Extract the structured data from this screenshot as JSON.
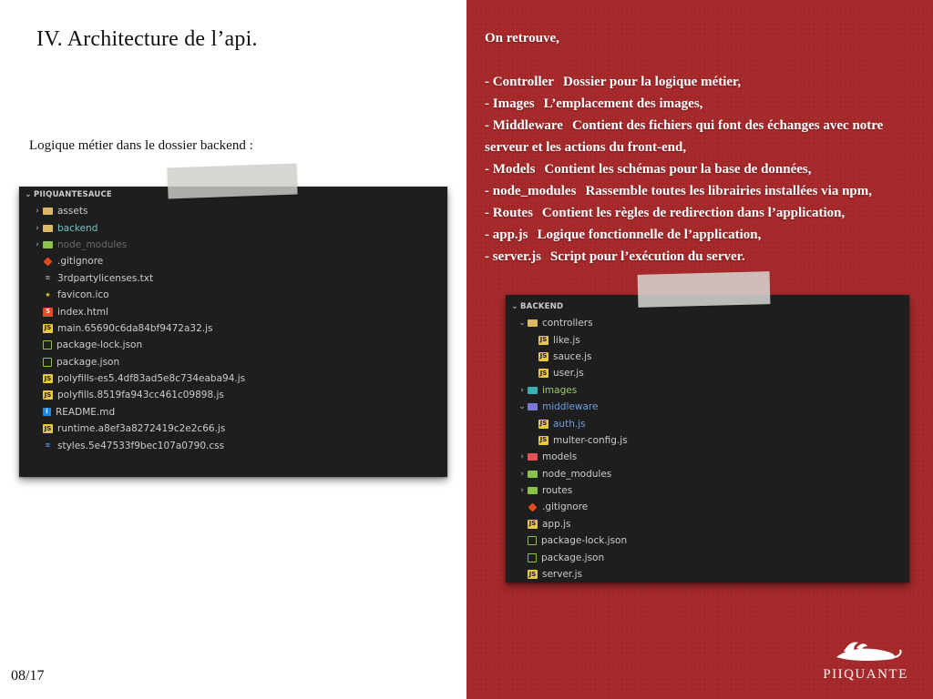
{
  "slide": {
    "title": "IV.  Architecture de l’api.",
    "subtitle": "Logique métier dans le dossier backend :",
    "page_number": "08/17"
  },
  "description": {
    "intro": "On retrouve,",
    "items": [
      {
        "name": "- Controller",
        "text": "Dossier pour la logique métier,"
      },
      {
        "name": "- Images",
        "text": "L’emplacement des images,"
      },
      {
        "name": "- Middleware",
        "text": "Contient des fichiers qui font des échanges avec notre serveur et les actions du front-end,"
      },
      {
        "name": "- Models",
        "text": "Contient les schémas pour la base de données,"
      },
      {
        "name": "- node_modules",
        "text": "Rassemble toutes les librairies installées via npm,"
      },
      {
        "name": "- Routes",
        "text": "Contient les règles de redirection dans l’application,"
      },
      {
        "name": "- app.js",
        "text": "Logique fonctionnelle de l’application,"
      },
      {
        "name": "- server.js",
        "text": "Script pour l’exécution du server."
      }
    ]
  },
  "left_explorer": {
    "header": "PIIQUANTESAUCE",
    "rows": [
      {
        "label": "assets",
        "twisty": "›",
        "icon": "folder-icon"
      },
      {
        "label": "backend",
        "twisty": "›",
        "icon": "folder-icon"
      },
      {
        "label": "node_modules",
        "twisty": "›",
        "icon": "folder-icon"
      },
      {
        "label": ".gitignore",
        "icon": "git-icon"
      },
      {
        "label": "3rdpartylicenses.txt",
        "icon": "text-file-icon"
      },
      {
        "label": "favicon.ico",
        "icon": "star-icon"
      },
      {
        "label": "index.html",
        "icon": "html-file-icon"
      },
      {
        "label": "main.65690c6da84bf9472a32.js",
        "icon": "js-file-icon"
      },
      {
        "label": "package-lock.json",
        "icon": "node-json-icon"
      },
      {
        "label": "package.json",
        "icon": "node-json-icon"
      },
      {
        "label": "polyfills-es5.4df83ad5e8c734eaba94.js",
        "icon": "js-file-icon"
      },
      {
        "label": "polyfills.8519fa943cc461c09898.js",
        "icon": "js-file-icon"
      },
      {
        "label": "README.md",
        "icon": "info-icon"
      },
      {
        "label": "runtime.a8ef3a8272419c2e2c66.js",
        "icon": "js-file-icon"
      },
      {
        "label": "styles.5e47533f9bec107a0790.css",
        "icon": "css-file-icon"
      }
    ]
  },
  "right_explorer": {
    "header": "BACKEND",
    "rows": [
      {
        "label": "controllers",
        "twisty": "⌄"
      },
      {
        "label": "like.js"
      },
      {
        "label": "sauce.js"
      },
      {
        "label": "user.js"
      },
      {
        "label": "images",
        "twisty": "›"
      },
      {
        "label": "middleware",
        "twisty": "⌄"
      },
      {
        "label": "auth.js"
      },
      {
        "label": "multer-config.js"
      },
      {
        "label": "models",
        "twisty": "›"
      },
      {
        "label": "node_modules",
        "twisty": "›"
      },
      {
        "label": "routes",
        "twisty": "›"
      },
      {
        "label": ".gitignore"
      },
      {
        "label": "app.js"
      },
      {
        "label": "package-lock.json"
      },
      {
        "label": "package.json"
      },
      {
        "label": "server.js"
      }
    ]
  },
  "logo": {
    "text": "PIIQUANTE"
  },
  "colors": {
    "right_background": "#a8292c",
    "panel_background": "#1e1e1e"
  }
}
